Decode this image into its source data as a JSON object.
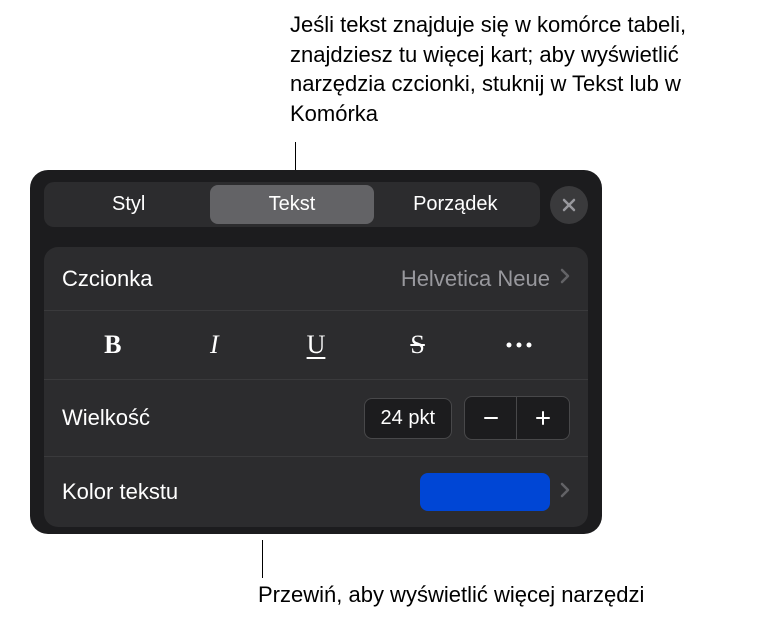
{
  "annotations": {
    "top": "Jeśli tekst znajduje się w komórce tabeli, znajdziesz tu więcej kart; aby wyświetlić narzędzia czcionki, stuknij w Tekst lub w Komórka",
    "bottom": "Przewiń, aby wyświetlić więcej narzędzi"
  },
  "tabs": {
    "style": "Styl",
    "text": "Tekst",
    "arrange": "Porządek"
  },
  "font": {
    "label": "Czcionka",
    "value": "Helvetica Neue"
  },
  "size": {
    "label": "Wielkość",
    "value": "24 pkt"
  },
  "textColor": {
    "label": "Kolor tekstu",
    "swatch": "#0046d5"
  }
}
